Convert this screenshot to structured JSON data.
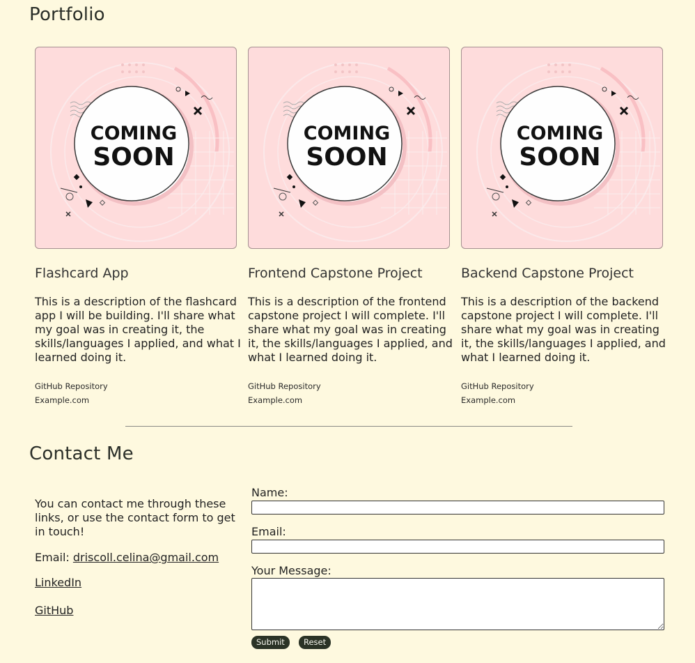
{
  "portfolio": {
    "title": "Portfolio",
    "cards": [
      {
        "image_label_line1": "COMING",
        "image_label_line2": "SOON",
        "title": "Flashcard App",
        "description": "This is a description of the flashcard app I will be building. I'll share what my goal was in creating it, the skills/languages I applied, and what I learned doing it.",
        "link1": "GitHub Repository",
        "link2": "Example.com"
      },
      {
        "image_label_line1": "COMING",
        "image_label_line2": "SOON",
        "title": "Frontend Capstone Project",
        "description": "This is a description of the frontend capstone project I will complete. I'll share what my goal was in creating it, the skills/languages I applied, and what I learned doing it.",
        "link1": "GitHub Repository",
        "link2": "Example.com"
      },
      {
        "image_label_line1": "COMING",
        "image_label_line2": "SOON",
        "title": "Backend Capstone Project",
        "description": "This is a description of the backend capstone project I will complete. I'll share what my goal was in creating it, the skills/languages I applied, and what I learned doing it.",
        "link1": "GitHub Repository",
        "link2": "Example.com"
      }
    ]
  },
  "contact": {
    "title": "Contact Me",
    "intro": "You can contact me through these links, or use the contact form to get in touch!",
    "email_prefix": "Email: ",
    "email": "driscoll.celina@gmail.com",
    "linkedin": "LinkedIn",
    "github": "GitHub",
    "form": {
      "name_label": "Name:",
      "email_label": "Email:",
      "message_label": "Your Message:",
      "name_value": "",
      "email_value": "",
      "message_value": "",
      "submit_label": "Submit",
      "reset_label": "Reset"
    }
  },
  "colors": {
    "background": "#fef9df",
    "card_image_bg": "#fedcdc",
    "button_bg": "#2b3326",
    "divider": "#8a8a84"
  }
}
